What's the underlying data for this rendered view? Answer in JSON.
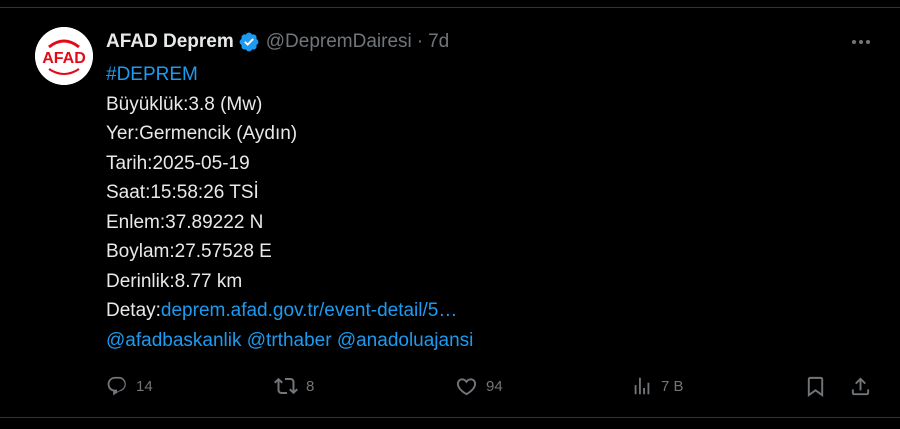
{
  "tweet": {
    "avatar_text": "AFAD",
    "display_name": "AFAD Deprem",
    "handle": "@DepremDairesi",
    "separator": "·",
    "time": "7d",
    "lines": {
      "hashtag": "#DEPREM",
      "magnitude": "Büyüklük:3.8 (Mw)",
      "location": "Yer:Germencik (Aydın)",
      "date": "Tarih:2025-05-19",
      "hour": "Saat:15:58:26 TSİ",
      "latitude": "Enlem:37.89222 N",
      "longitude": "Boylam:27.57528 E",
      "depth": "Derinlik:8.77 km",
      "detail_label": "Detay:",
      "detail_link": "deprem.afad.gov.tr/event-detail/5…",
      "mentions": [
        "@afadbaskanlik",
        "@trthaber",
        "@anadoluajansi"
      ]
    },
    "actions": {
      "replies": "14",
      "reposts": "8",
      "likes": "94",
      "views": "7 B"
    }
  },
  "colors": {
    "background": "#000000",
    "text": "#e7e9ea",
    "secondary": "#71767b",
    "link": "#1d9bf0",
    "verified": "#1d9bf0",
    "avatar_red": "#e30a17"
  },
  "icons": [
    "verified-badge-icon",
    "more-icon",
    "reply-icon",
    "repost-icon",
    "like-icon",
    "views-icon",
    "bookmark-icon",
    "share-icon"
  ]
}
